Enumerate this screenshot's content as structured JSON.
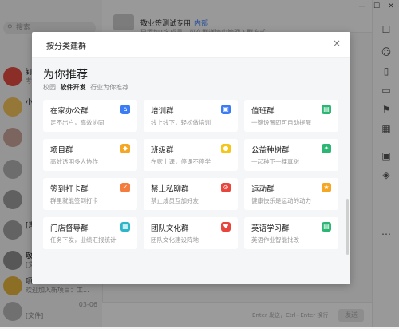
{
  "background": {
    "search_placeholder": "搜索",
    "chat_header": {
      "title": "敬业签测试专用",
      "tag": "内部",
      "subtitle": "已添加1名成员，可在群详情中管理入群方式"
    },
    "conversations": [
      {
        "name": "钉",
        "msg": "考",
        "time": "",
        "avatar_color": "#e04b3f"
      },
      {
        "name": "小",
        "msg": "",
        "time": "",
        "avatar_color": "#f0c05a"
      },
      {
        "name": "",
        "msg": "",
        "time": "",
        "avatar_color": "#c9a39a"
      },
      {
        "name": "",
        "msg": "",
        "time": "",
        "avatar_color": "#b0b0b0"
      },
      {
        "name": "",
        "msg": "",
        "time": "",
        "avatar_color": "#9c9c9c"
      },
      {
        "name": "[声",
        "msg": "",
        "time": "",
        "avatar_color": "#a0a0a0"
      },
      {
        "name": "敬",
        "msg": "[文",
        "time": "",
        "avatar_color": "#8d8d8d"
      },
      {
        "name": "项",
        "msg": "欢迎加入新项目：工...",
        "time": "",
        "avatar_color": "#e2b23d"
      },
      {
        "name": "",
        "msg": "[文件]",
        "time": "03-06",
        "avatar_color": "#b5b5b5"
      }
    ],
    "input_hint": "Enter 发送，Ctrl+Enter 换行",
    "send_label": "发送"
  },
  "modal": {
    "title": "按分类建群",
    "close": "×",
    "rec_title": "为你推荐",
    "filter": {
      "label": "校园",
      "active": "软件开发",
      "other": "行业为你推荐"
    },
    "cards": [
      {
        "title": "在家办公群",
        "desc": "足不出户，高效协同",
        "icon_color": "#3b7bf6",
        "icon": "⌂"
      },
      {
        "title": "培训群",
        "desc": "线上线下，轻松做培训",
        "icon_color": "#3b7bf6",
        "icon": "▣"
      },
      {
        "title": "值班群",
        "desc": "一键设置即可自动提醒",
        "icon_color": "#2bb673",
        "icon": "▤"
      },
      {
        "title": "项目群",
        "desc": "高效透明多人协作",
        "icon_color": "#f5a623",
        "icon": "◆"
      },
      {
        "title": "班级群",
        "desc": "在家上课，停课不停学",
        "icon_color": "#f5c518",
        "icon": "●"
      },
      {
        "title": "公益种树群",
        "desc": "一起种下一棵真树",
        "icon_color": "#2bb673",
        "icon": "✦"
      },
      {
        "title": "签到打卡群",
        "desc": "群里就能签到打卡",
        "icon_color": "#f47c3c",
        "icon": "✓"
      },
      {
        "title": "禁止私聊群",
        "desc": "禁止成员互加好友",
        "icon_color": "#e8453c",
        "icon": "⊘"
      },
      {
        "title": "运动群",
        "desc": "健康快乐是运动的动力",
        "icon_color": "#f5a623",
        "icon": "★"
      },
      {
        "title": "门店督导群",
        "desc": "任务下发，业绩汇报统计",
        "icon_color": "#2bb6c9",
        "icon": "▦"
      },
      {
        "title": "团队文化群",
        "desc": "团队文化建设阵地",
        "icon_color": "#e8453c",
        "icon": "♥"
      },
      {
        "title": "英语学习群",
        "desc": "英语作业智能批改",
        "icon_color": "#2bb673",
        "icon": "▤"
      }
    ]
  }
}
